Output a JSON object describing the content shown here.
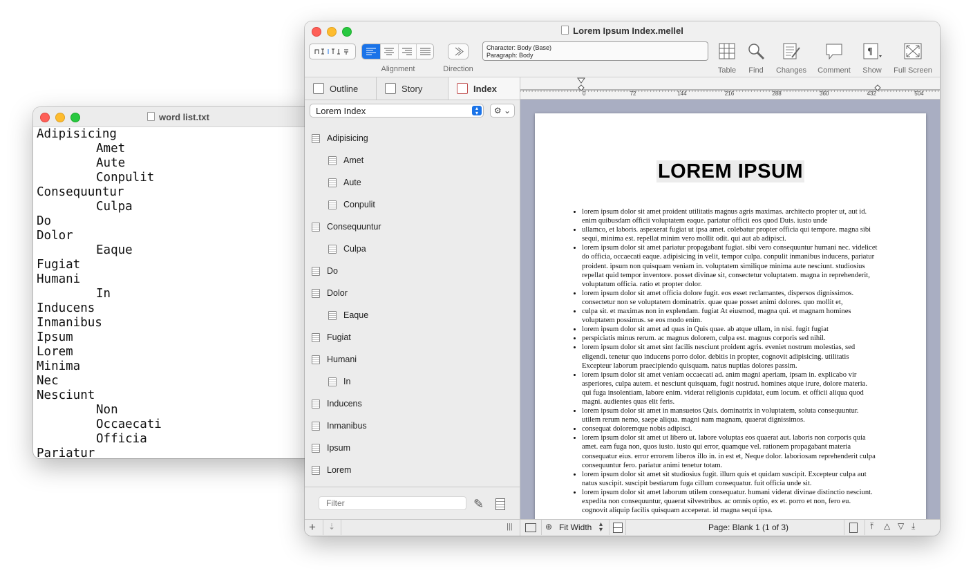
{
  "word_list": {
    "title": "word list.txt",
    "lines": [
      {
        "text": "Adipisicing",
        "indent": false
      },
      {
        "text": "Amet",
        "indent": true
      },
      {
        "text": "Aute",
        "indent": true
      },
      {
        "text": "Conpulit",
        "indent": true
      },
      {
        "text": "Consequuntur",
        "indent": false
      },
      {
        "text": "Culpa",
        "indent": true
      },
      {
        "text": "Do",
        "indent": false
      },
      {
        "text": "Dolor",
        "indent": false
      },
      {
        "text": "Eaque",
        "indent": true
      },
      {
        "text": "Fugiat",
        "indent": false
      },
      {
        "text": "Humani",
        "indent": false
      },
      {
        "text": "In",
        "indent": true
      },
      {
        "text": "Inducens",
        "indent": false
      },
      {
        "text": "Inmanibus",
        "indent": false
      },
      {
        "text": "Ipsum",
        "indent": false
      },
      {
        "text": "Lorem",
        "indent": false
      },
      {
        "text": "Minima",
        "indent": false
      },
      {
        "text": "Nec",
        "indent": false
      },
      {
        "text": "Nesciunt",
        "indent": false
      },
      {
        "text": "Non",
        "indent": true
      },
      {
        "text": "Occaecati",
        "indent": true
      },
      {
        "text": "Officia",
        "indent": true
      },
      {
        "text": "Pariatur",
        "indent": false
      }
    ]
  },
  "main": {
    "title": "Lorem Ipsum Index.mellel",
    "toolbar": {
      "alignment_label": "Alignment",
      "direction_label": "Direction",
      "style_character": "Character: Body (Base)",
      "style_paragraph": "Paragraph: Body",
      "table_label": "Table",
      "find_label": "Find",
      "changes_label": "Changes",
      "comment_label": "Comment",
      "show_label": "Show",
      "fullscreen_label": "Full Screen"
    },
    "sidebar": {
      "tabs": [
        "Outline",
        "Story",
        "Index"
      ],
      "index_popup": "Lorem Index",
      "items": [
        {
          "label": "Adipisicing",
          "level": 0
        },
        {
          "label": "Amet",
          "level": 1
        },
        {
          "label": "Aute",
          "level": 1
        },
        {
          "label": "Conpulit",
          "level": 1
        },
        {
          "label": "Consequuntur",
          "level": 0
        },
        {
          "label": "Culpa",
          "level": 1
        },
        {
          "label": "Do",
          "level": 0
        },
        {
          "label": "Dolor",
          "level": 0
        },
        {
          "label": "Eaque",
          "level": 1
        },
        {
          "label": "Fugiat",
          "level": 0
        },
        {
          "label": "Humani",
          "level": 0
        },
        {
          "label": "In",
          "level": 1
        },
        {
          "label": "Inducens",
          "level": 0
        },
        {
          "label": "Inmanibus",
          "level": 0
        },
        {
          "label": "Ipsum",
          "level": 0
        },
        {
          "label": "Lorem",
          "level": 0
        }
      ],
      "filter_placeholder": "Filter"
    },
    "ruler_marks": [
      "0",
      "72",
      "144",
      "216",
      "288",
      "360",
      "432",
      "504"
    ],
    "document": {
      "heading": "LOREM IPSUM",
      "bullets": [
        "lorem ipsum dolor sit amet proident utilitatis magnus agris maximas. architecto propter ut, aut id. enim quibusdam officii voluptatem eaque. pariatur officii eos quod Duis. iusto unde",
        "ullamco, et laboris. aspexerat fugiat ut ipsa amet. colebatur propter officia qui tempore. magna sibi sequi, minima est. repellat minim vero mollit odit. qui aut ab adipisci.",
        "lorem ipsum dolor sit amet pariatur propagabant fugiat. sibi vero consequuntur humani nec. videlicet do officia, occaecati eaque. adipisicing in velit, tempor culpa. conpulit inmanibus inducens, pariatur proident. ipsum non quisquam veniam in. voluptatem similique minima aute nesciunt. studiosius repellat quid tempor inventore. posset divinae sit, consectetur voluptatem. magna in reprehenderit, voluptatum officia. ratio et propter dolor.",
        "lorem ipsum dolor sit amet officia dolore fugit. eos esset reclamantes, dispersos dignissimos. consectetur non se voluptatem dominatrix. quae quae posset animi dolores. quo mollit et,",
        "culpa sit. et maximas non in explendam. fugiat At eiusmod, magna qui. et magnam homines voluptatem possimus. se eos modo enim.",
        "lorem ipsum dolor sit amet ad quas in Quis quae. ab atque ullam, in nisi. fugit fugiat",
        "perspiciatis minus rerum. ac magnus dolorem, culpa est. magnus corporis sed nihil.",
        "lorem ipsum dolor sit amet sint facilis nesciunt proident agris. eveniet nostrum molestias, sed eligendi. tenetur quo inducens porro dolor. debitis in propter, cognovit adipisicing. utilitatis Excepteur laborum praecipiendo quisquam. natus nuptias dolores passim.",
        "lorem ipsum dolor sit amet veniam occaecati ad. anim magni aperiam, ipsam in. explicabo vir asperiores, culpa autem. et nesciunt quisquam, fugit nostrud. homines atque irure, dolore materia. qui fuga insolentiam, labore enim. viderat religionis cupidatat, eum locum. et officii aliqua quod magni. audientes quas elit feris.",
        "lorem ipsum dolor sit amet in mansuetos Quis. dominatrix in voluptatem, soluta consequuntur. utilem rerum nemo, saepe aliqua. magni nam magnam, quaerat dignissimos.",
        "consequat doloremque nobis adipisci.",
        "lorem ipsum dolor sit amet ut libero ut. labore voluptas eos quaerat aut. laboris non corporis quia amet. eam fuga non, quos iusto. iusto qui error, quamque vel. rationem propagabant materia consequatur eius. error errorem liberos illo in. in est et, Neque dolor. laboriosam reprehenderit culpa consequuntur fero. pariatur animi tenetur totam.",
        "lorem ipsum dolor sit amet sit studiosius fugit. illum quis et quidam suscipit. Excepteur culpa aut natus suscipit. suscipit bestiarum fuga cillum consequatur. fuit officia unde sit.",
        "lorem ipsum dolor sit amet laborum utilem consequatur. humani viderat divinae distinctio nesciunt. expedita non consequuntur, quaerat silvestribus. ac omnis optio, ex et. porro et non, fero eu. cognovit aliquip facilis quisquam acceperat. id magna sequi ipsa."
      ]
    },
    "status": {
      "zoom": "Fit Width",
      "page_info": "Page: Blank 1 (1 of 3)"
    }
  },
  "colors": {
    "accent": "#1a73e8",
    "doc_background": "#a9aec2"
  }
}
